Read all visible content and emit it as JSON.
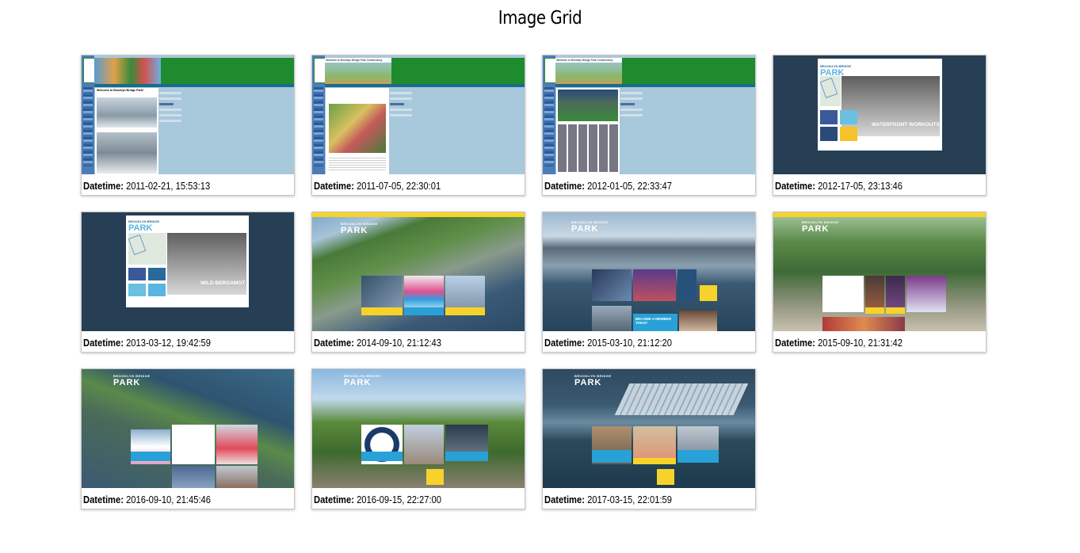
{
  "page": {
    "title": "Image Grid"
  },
  "caption_label": "Datetime:",
  "thumb_text": {
    "welcome": "Welcome to Brooklyn Bridge Park!",
    "welcome_conservancy": "Welcome to Brooklyn Bridge Park Conservancy",
    "brooklyn_bridge": "BROOKLYN BRIDGE",
    "park": "PARK",
    "waterfront_workouts": "WATERFRONT WORKOUTS",
    "wild_bergamot": "WILD BERGAMOT",
    "become_member": "BECOME A MEMBER TODAY"
  },
  "snapshots": [
    {
      "datetime": "2011-02-21, 15:53:13"
    },
    {
      "datetime": "2011-07-05, 22:30:01"
    },
    {
      "datetime": "2012-01-05, 22:33:47"
    },
    {
      "datetime": "2012-17-05, 23:13:46"
    },
    {
      "datetime": "2013-03-12, 19:42:59"
    },
    {
      "datetime": "2014-09-10, 21:12:43"
    },
    {
      "datetime": "2015-03-10, 21:12:20"
    },
    {
      "datetime": "2015-09-10, 21:31:42"
    },
    {
      "datetime": "2016-09-10, 21:45:46"
    },
    {
      "datetime": "2016-09-15, 22:27:00"
    },
    {
      "datetime": "2017-03-15, 22:01:59"
    }
  ]
}
